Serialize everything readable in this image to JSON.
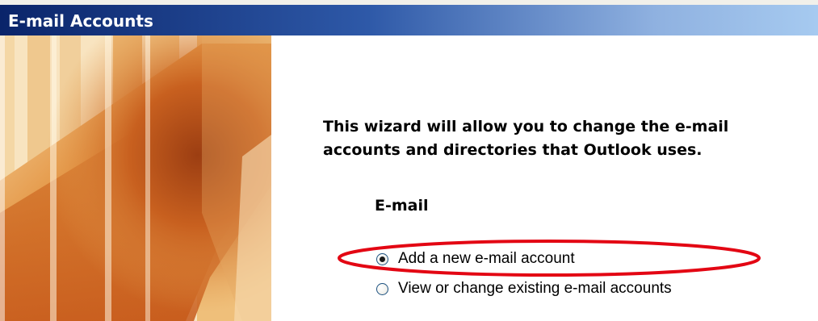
{
  "window": {
    "title": "E-mail Accounts"
  },
  "wizard": {
    "intro_text": "This wizard will allow you to change the e-mail accounts and directories that Outlook uses.",
    "email_section_label": "E-mail",
    "options": [
      {
        "label": "Add a new e-mail account",
        "selected": true
      },
      {
        "label": "View or change existing e-mail accounts",
        "selected": false
      }
    ]
  },
  "annotation": {
    "highlight_color": "#e30613"
  },
  "colors": {
    "title_bar_start": "#0a246a",
    "title_bar_end": "#a6caf0",
    "banner_orange": "#d9782a"
  }
}
